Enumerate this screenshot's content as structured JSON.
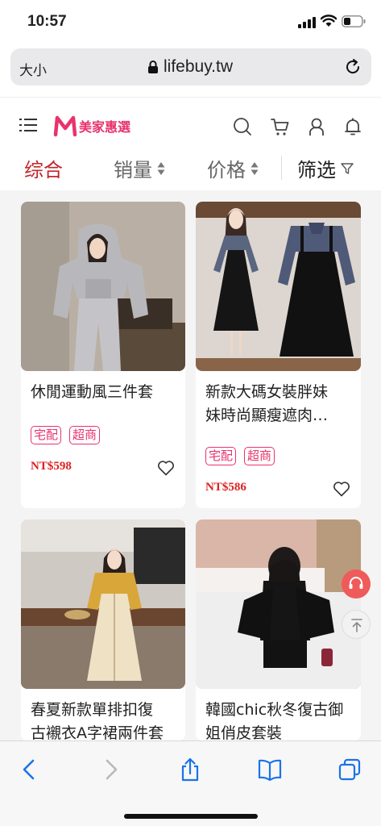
{
  "status_bar": {
    "time": "10:57"
  },
  "browser": {
    "text_size_label": "大小",
    "host": "lifebuy.tw"
  },
  "site": {
    "logo_text": "美家惠選",
    "brand_color": "#e8336d"
  },
  "sort_tabs": [
    {
      "label": "综合",
      "active": true
    },
    {
      "label": "销量"
    },
    {
      "label": "价格"
    },
    {
      "label": "筛选"
    }
  ],
  "products": [
    {
      "title_lines": [
        "休閒運動風三件套"
      ],
      "tags": [
        "宅配",
        "超商"
      ],
      "price": "NT$598"
    },
    {
      "title_lines": [
        "新款大碼女裝胖妹",
        "妹時尚顯瘦遮肉…"
      ],
      "tags": [
        "宅配",
        "超商"
      ],
      "price": "NT$586"
    },
    {
      "title_lines": [
        "春夏新款單排扣復",
        "古襯衣A字裙兩件套"
      ]
    },
    {
      "title_lines": [
        "韓國chic秋冬復古御",
        "姐俏皮套裝"
      ]
    }
  ],
  "icons": [
    "menu-icon",
    "search-icon",
    "cart-icon",
    "user-icon",
    "bell-icon",
    "filter-icon",
    "heart-icon",
    "headset-icon",
    "arrow-up-icon",
    "lock-icon",
    "reload-icon",
    "back-icon",
    "forward-icon",
    "share-icon",
    "bookmarks-icon",
    "tabs-icon"
  ]
}
